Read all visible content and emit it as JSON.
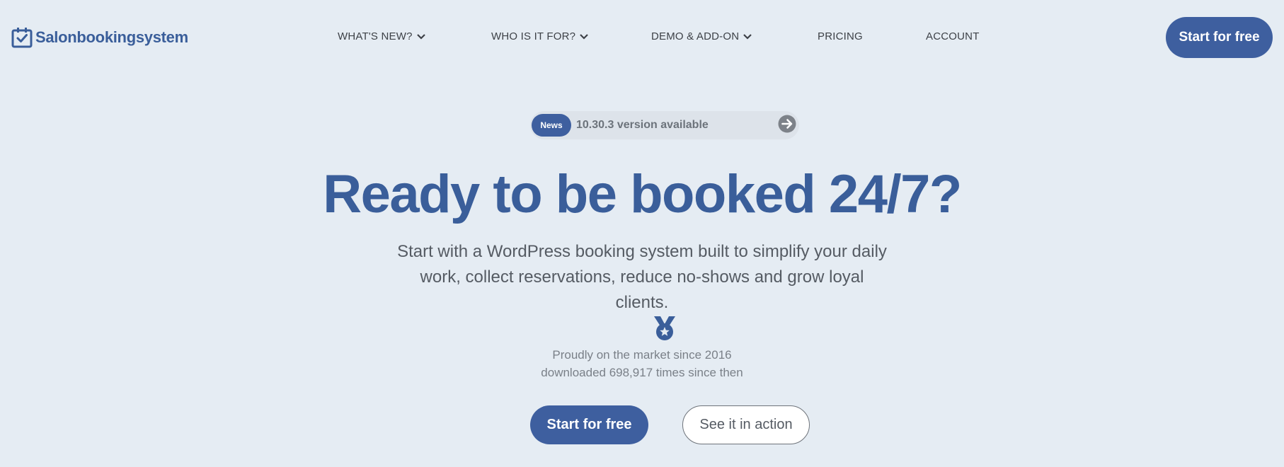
{
  "header": {
    "logo_text": "Salonbookingsystem",
    "nav": [
      {
        "label": "WHAT'S NEW?",
        "has_dropdown": true
      },
      {
        "label": "WHO IS IT FOR?",
        "has_dropdown": true
      },
      {
        "label": "DEMO & ADD-ON",
        "has_dropdown": true
      },
      {
        "label": "PRICING",
        "has_dropdown": false
      },
      {
        "label": "ACCOUNT",
        "has_dropdown": false
      }
    ],
    "cta_label": "Start for free"
  },
  "news": {
    "badge": "News",
    "text": "10.30.3 version available",
    "arrow_icon": "arrow-right-circle-icon"
  },
  "hero": {
    "title": "Ready to be booked 24/7?",
    "subtitle_line1": "Start with a WordPress booking system built to simplify your daily",
    "subtitle_line2": "work, collect reservations, reduce no-shows and grow loyal clients.",
    "medal_icon": "medal-icon",
    "market_line1": "Proudly on the market since 2016",
    "market_line2": "downloaded 698,917 times since then",
    "primary_cta": "Start for free",
    "secondary_cta": "See it in action"
  },
  "colors": {
    "background": "#e5ecf3",
    "brand": "#3e5f9f",
    "title": "#3a5e9a",
    "news_bar": "#dde3ea"
  }
}
